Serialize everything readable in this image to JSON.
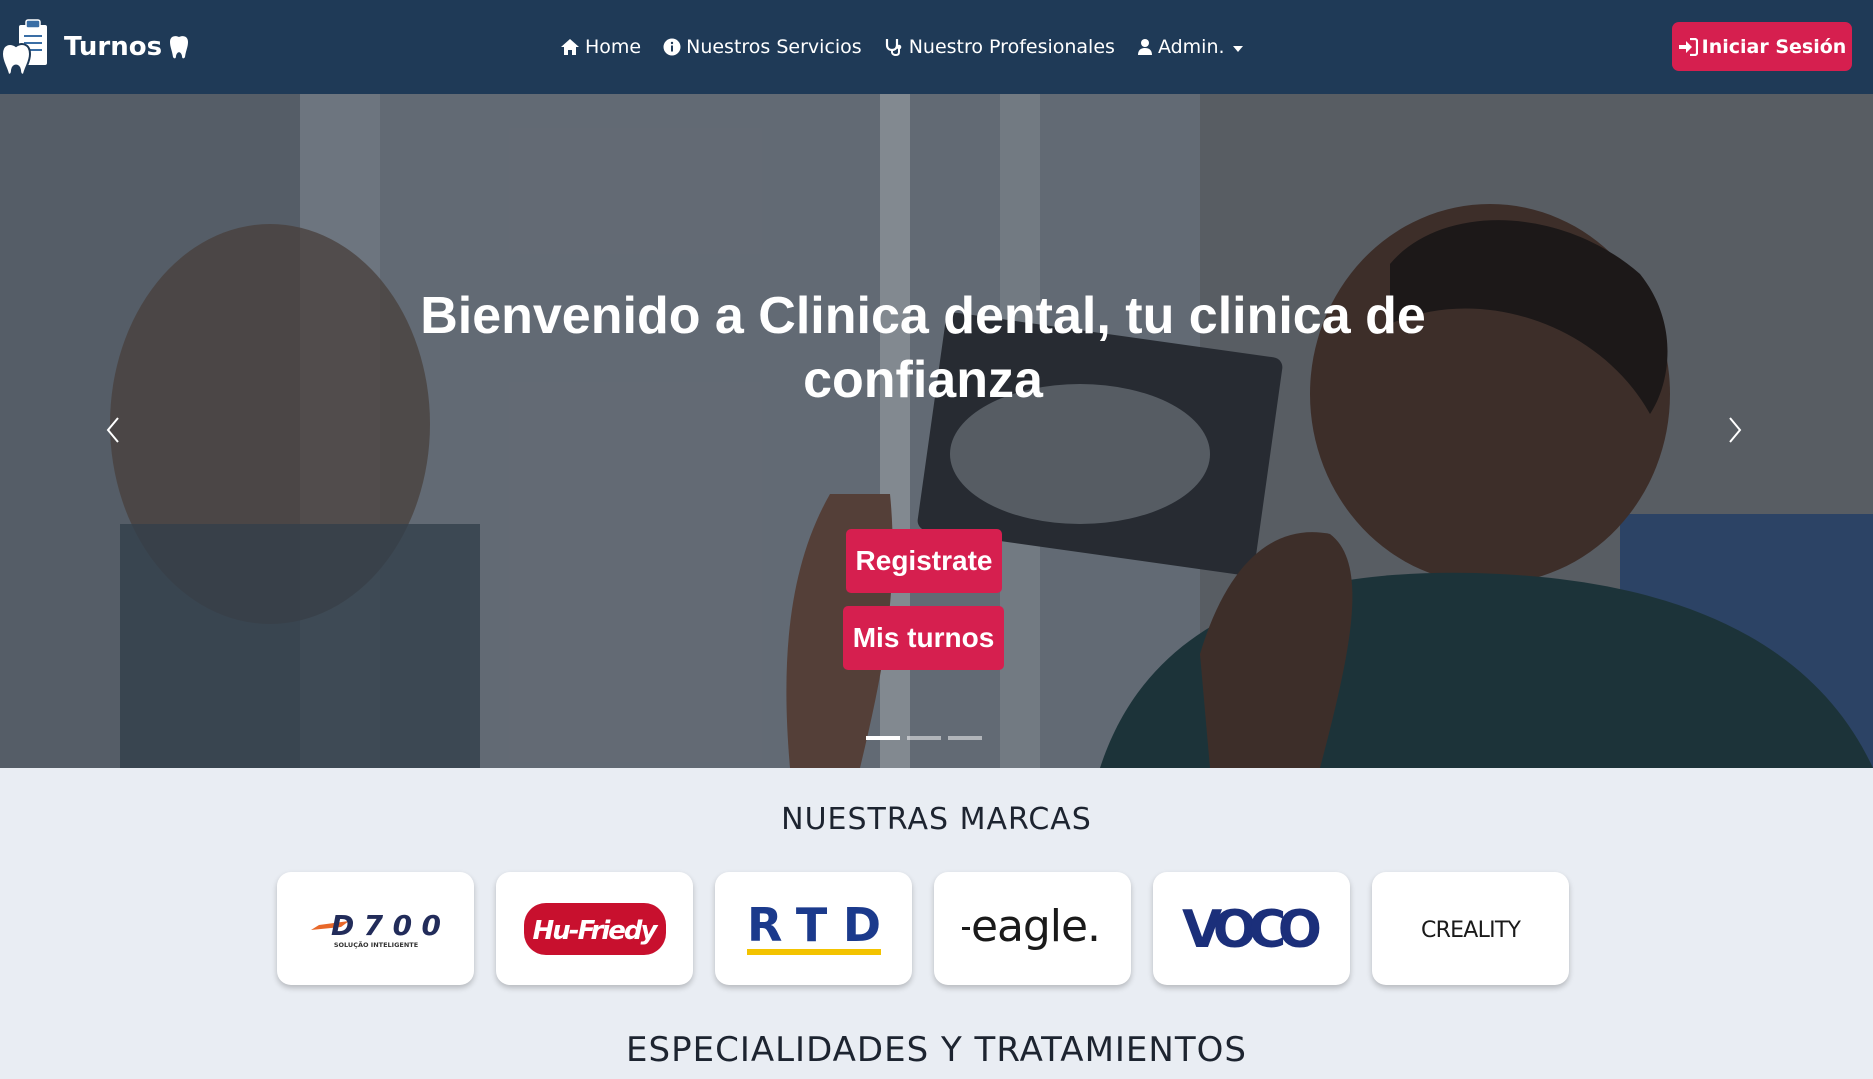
{
  "navbar": {
    "brand_name": "Turnos",
    "links": [
      {
        "label": "Home",
        "icon": "home-icon"
      },
      {
        "label": "Nuestros Servicios",
        "icon": "info-circle-icon"
      },
      {
        "label": "Nuestro Profesionales",
        "icon": "stethoscope-icon"
      },
      {
        "label": "Admin.",
        "icon": "user-icon"
      }
    ],
    "login_label": "Iniciar Sesión"
  },
  "hero": {
    "title": "Bienvenido a Clinica dental, tu clinica de confianza",
    "register_label": "Registrate",
    "my_turns_label": "Mis turnos",
    "slides_count": 3,
    "active_slide": 1
  },
  "brands": {
    "title": "NUESTRAS MARCAS",
    "items": [
      {
        "name": "D700",
        "subtitle": "SOLUÇÃO INTELIGENTE"
      },
      {
        "name": "Hu-Friedy"
      },
      {
        "name": "RTD"
      },
      {
        "name": "eagle."
      },
      {
        "name": "VOCO"
      },
      {
        "name": "CREALITY"
      }
    ]
  },
  "specialties": {
    "title": "ESPECIALIDADES Y TRATAMIENTOS"
  },
  "colors": {
    "navbar": "#1f3a57",
    "accent": "#d61f4f",
    "page_bg": "#e9edf3"
  }
}
